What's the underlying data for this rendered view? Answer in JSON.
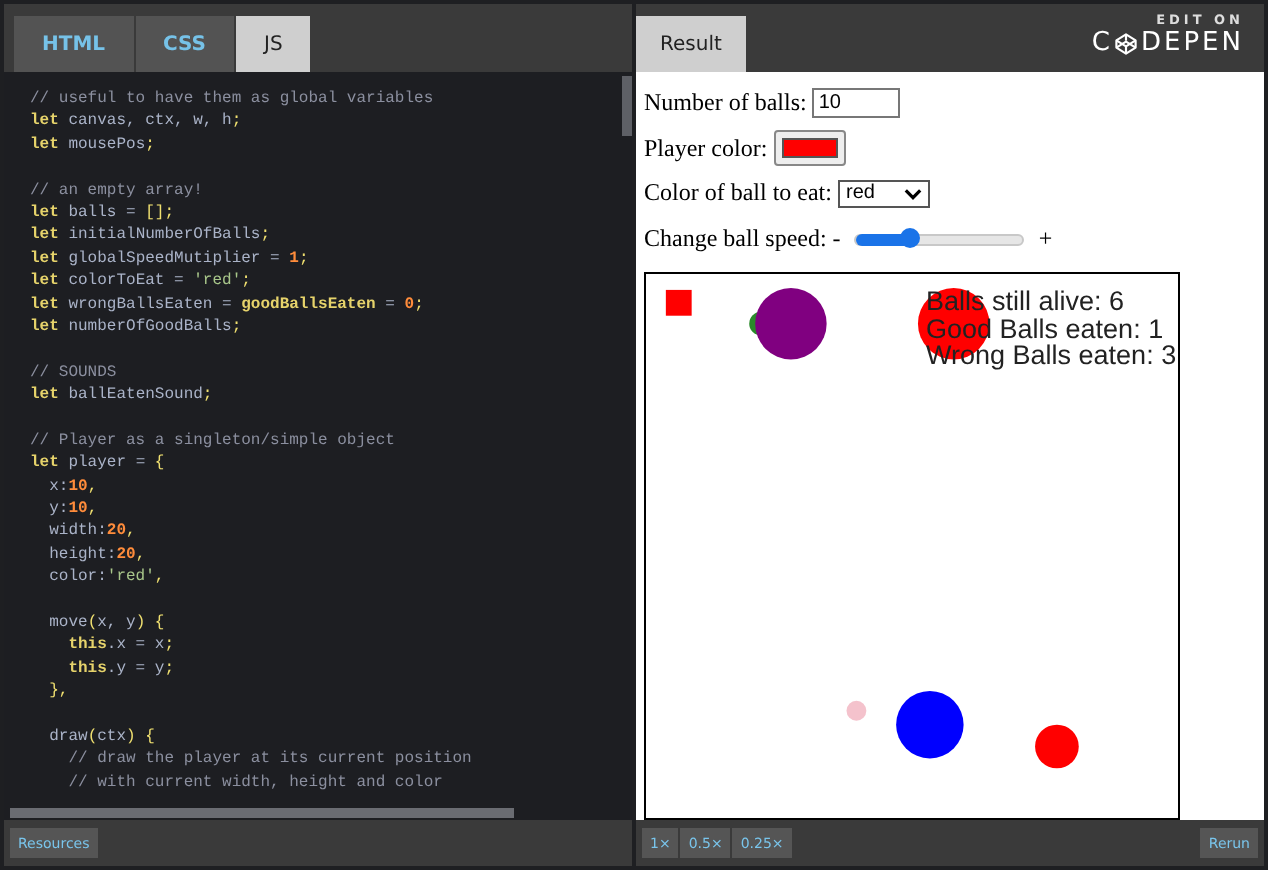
{
  "editor_tabs": [
    {
      "label": "HTML",
      "selected": false
    },
    {
      "label": "CSS",
      "selected": false
    },
    {
      "label": "JS",
      "selected": true
    }
  ],
  "result_tab": {
    "label": "Result",
    "selected": true
  },
  "brand": {
    "kicker": "EDIT ON",
    "prefix": "C",
    "suffix": "DEPEN"
  },
  "code_blocks": [
    [
      [
        {
          "t": "// useful to have them as global variables",
          "kind": "comment"
        }
      ],
      [
        {
          "t": "let",
          "kind": "keyword"
        },
        {
          "t": " canvas, ctx, w, h",
          "kind": "name"
        },
        {
          "t": ";",
          "kind": "punct"
        }
      ],
      [
        {
          "t": "let",
          "kind": "keyword"
        },
        {
          "t": " mousePos",
          "kind": "name"
        },
        {
          "t": ";",
          "kind": "punct"
        }
      ]
    ],
    [
      [
        {
          "t": "// an empty array!",
          "kind": "comment"
        }
      ],
      [
        {
          "t": "let",
          "kind": "keyword"
        },
        {
          "t": " balls = ",
          "kind": "name"
        },
        {
          "t": "[];",
          "kind": "punct"
        }
      ],
      [
        {
          "t": "let",
          "kind": "keyword"
        },
        {
          "t": " initialNumberOfBalls",
          "kind": "name"
        },
        {
          "t": ";",
          "kind": "punct"
        }
      ],
      [
        {
          "t": "let",
          "kind": "keyword"
        },
        {
          "t": " globalSpeedMutiplier = ",
          "kind": "name"
        },
        {
          "t": "1",
          "kind": "number"
        },
        {
          "t": ";",
          "kind": "punct"
        }
      ],
      [
        {
          "t": "let",
          "kind": "keyword"
        },
        {
          "t": " colorToEat = ",
          "kind": "name"
        },
        {
          "t": "'red'",
          "kind": "string"
        },
        {
          "t": ";",
          "kind": "punct"
        }
      ],
      [
        {
          "t": "let",
          "kind": "keyword"
        },
        {
          "t": " wrongBallsEaten = ",
          "kind": "name"
        },
        {
          "t": "goodBallsEaten",
          "kind": "def"
        },
        {
          "t": " = ",
          "kind": "name"
        },
        {
          "t": "0",
          "kind": "number"
        },
        {
          "t": ";",
          "kind": "punct"
        }
      ],
      [
        {
          "t": "let",
          "kind": "keyword"
        },
        {
          "t": " numberOfGoodBalls",
          "kind": "name"
        },
        {
          "t": ";",
          "kind": "punct"
        }
      ]
    ],
    [
      [
        {
          "t": "// SOUNDS",
          "kind": "comment"
        }
      ],
      [
        {
          "t": "let",
          "kind": "keyword"
        },
        {
          "t": " ballEatenSound",
          "kind": "name"
        },
        {
          "t": ";",
          "kind": "punct"
        }
      ]
    ],
    [
      [
        {
          "t": "// Player as a singleton/simple object",
          "kind": "comment"
        }
      ],
      [
        {
          "t": "let",
          "kind": "keyword"
        },
        {
          "t": " player = ",
          "kind": "name"
        },
        {
          "t": "{",
          "kind": "punct"
        }
      ],
      [
        {
          "t": "  x:",
          "kind": "name"
        },
        {
          "t": "10",
          "kind": "number"
        },
        {
          "t": ",",
          "kind": "punct"
        }
      ],
      [
        {
          "t": "  y:",
          "kind": "name"
        },
        {
          "t": "10",
          "kind": "number"
        },
        {
          "t": ",",
          "kind": "punct"
        }
      ],
      [
        {
          "t": "  width:",
          "kind": "name"
        },
        {
          "t": "20",
          "kind": "number"
        },
        {
          "t": ",",
          "kind": "punct"
        }
      ],
      [
        {
          "t": "  height:",
          "kind": "name"
        },
        {
          "t": "20",
          "kind": "number"
        },
        {
          "t": ",",
          "kind": "punct"
        }
      ],
      [
        {
          "t": "  color:",
          "kind": "name"
        },
        {
          "t": "'red'",
          "kind": "string"
        },
        {
          "t": ",",
          "kind": "punct"
        }
      ]
    ],
    [
      [
        {
          "t": "  move",
          "kind": "name"
        },
        {
          "t": "(",
          "kind": "punct"
        },
        {
          "t": "x, y",
          "kind": "name"
        },
        {
          "t": ") {",
          "kind": "punct"
        }
      ],
      [
        {
          "t": "    this",
          "kind": "def"
        },
        {
          "t": ".x = x",
          "kind": "name"
        },
        {
          "t": ";",
          "kind": "punct"
        }
      ],
      [
        {
          "t": "    this",
          "kind": "def"
        },
        {
          "t": ".y = y",
          "kind": "name"
        },
        {
          "t": ";",
          "kind": "punct"
        }
      ],
      [
        {
          "t": "  },",
          "kind": "punct"
        }
      ]
    ],
    [
      [
        {
          "t": "  draw",
          "kind": "name"
        },
        {
          "t": "(",
          "kind": "punct"
        },
        {
          "t": "ctx",
          "kind": "name"
        },
        {
          "t": ") {",
          "kind": "punct"
        }
      ],
      [
        {
          "t": "    // draw the player at its current position",
          "kind": "comment"
        }
      ],
      [
        {
          "t": "    // with current width, height and color",
          "kind": "comment"
        }
      ]
    ]
  ],
  "form": {
    "balls_label": "Number of balls:",
    "balls_value": "10",
    "player_color_label": "Player color:",
    "player_swatch": {
      "kind": "red"
    },
    "eat_label": "Color of ball to eat:",
    "eat_value": "red",
    "speed_label": "Change ball speed: -",
    "speed": {
      "level": 0.32
    },
    "speed_plus": "+"
  },
  "game_stats": [
    "Balls still alive: 6",
    "Good Balls eaten: 1",
    "Wrong Balls eaten: 3"
  ],
  "footer": {
    "resources": "Resources",
    "zooms": [
      {
        "label": "1×",
        "selected": false
      },
      {
        "label": "0.5×",
        "selected": false
      },
      {
        "label": "0.25×",
        "selected": false
      }
    ],
    "rerun": "Rerun"
  }
}
